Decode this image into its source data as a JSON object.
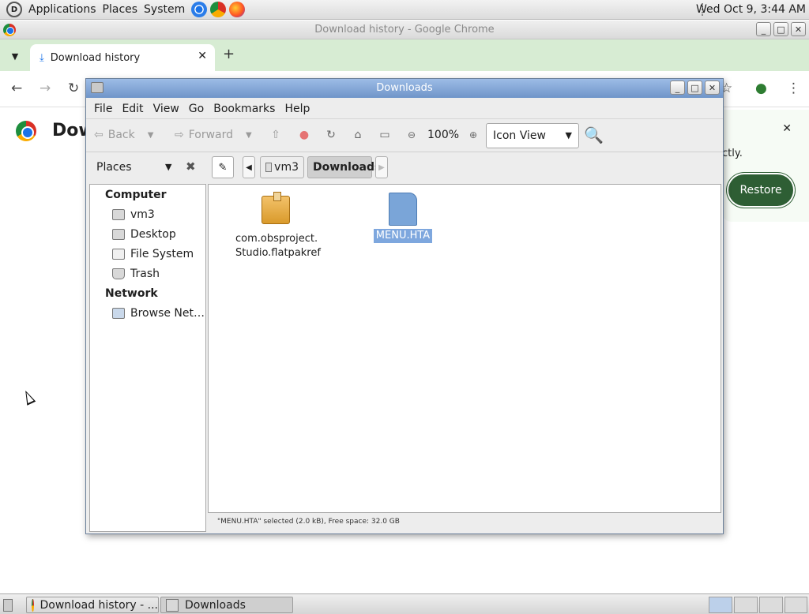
{
  "top_panel": {
    "menus": [
      "Applications",
      "Places",
      "System"
    ],
    "clock": "Wed Oct  9,  3:44 AM"
  },
  "chrome": {
    "window_title": "Download history - Google Chrome",
    "tab_title": "Download history",
    "page_title": "Dow",
    "banner_partial_text": "ctly.",
    "restore_label": "Restore"
  },
  "nautilus": {
    "window_title": "Downloads",
    "menus": [
      "File",
      "Edit",
      "View",
      "Go",
      "Bookmarks",
      "Help"
    ],
    "toolbar": {
      "back": "Back",
      "forward": "Forward",
      "zoom": "100%",
      "view_mode": "Icon View"
    },
    "sidebar_mode": "Places",
    "breadcrumbs": [
      "vm3",
      "Downloads"
    ],
    "sidebar": {
      "computer_header": "Computer",
      "computer_items": [
        "vm3",
        "Desktop",
        "File System",
        "Trash"
      ],
      "network_header": "Network",
      "network_items": [
        "Browse Net…"
      ]
    },
    "files": [
      {
        "line1": "com.obsproject.",
        "line2": "Studio.flatpakref"
      },
      {
        "line1": "MENU.HTA"
      }
    ],
    "status": "\"MENU.HTA\" selected (2.0 kB), Free space: 32.0 GB"
  },
  "taskbar": {
    "tasks": [
      "Download history - ...",
      "Downloads"
    ]
  }
}
